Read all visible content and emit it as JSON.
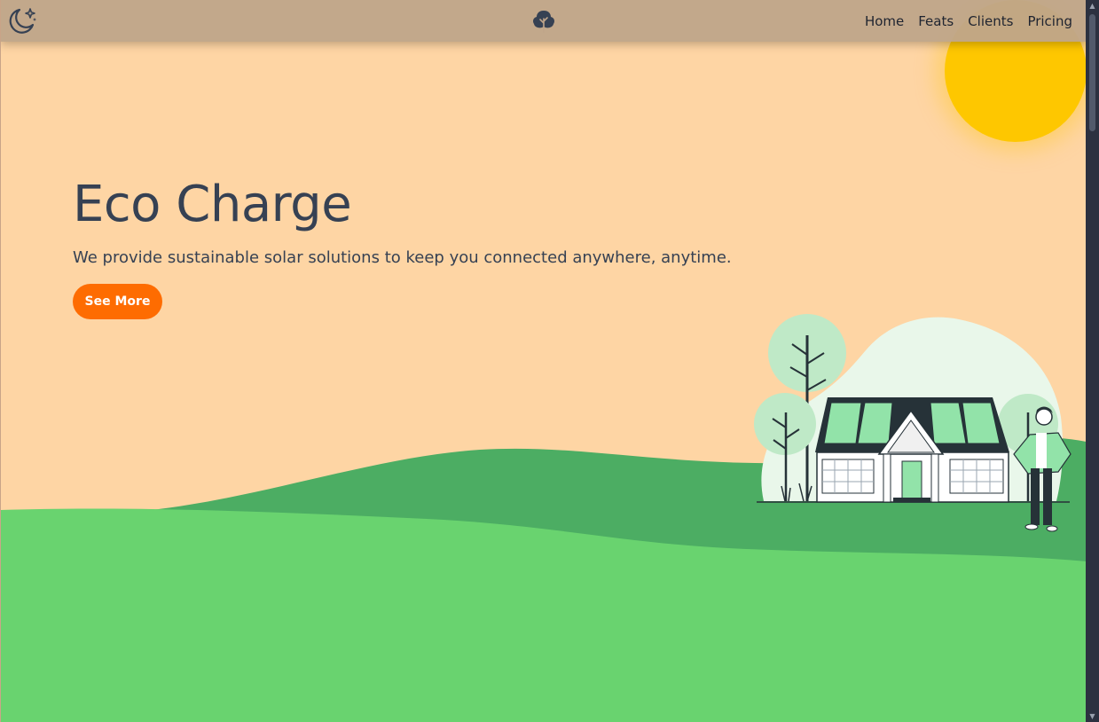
{
  "nav": {
    "links": [
      "Home",
      "Feats",
      "Clients",
      "Pricing"
    ]
  },
  "hero": {
    "title": "Eco Charge",
    "subtitle": "We provide sustainable solar solutions to keep you connected anywhere, anytime.",
    "cta_label": "See More"
  },
  "icons": {
    "theme_toggle": "moon-stars-icon",
    "logo": "tree-leaf-icon"
  },
  "colors": {
    "background": "#fed5a4",
    "sun": "#fec700",
    "hill_dark": "#4cad63",
    "hill_light": "#69d36f",
    "accent": "#fe6c01",
    "text": "#364153"
  }
}
